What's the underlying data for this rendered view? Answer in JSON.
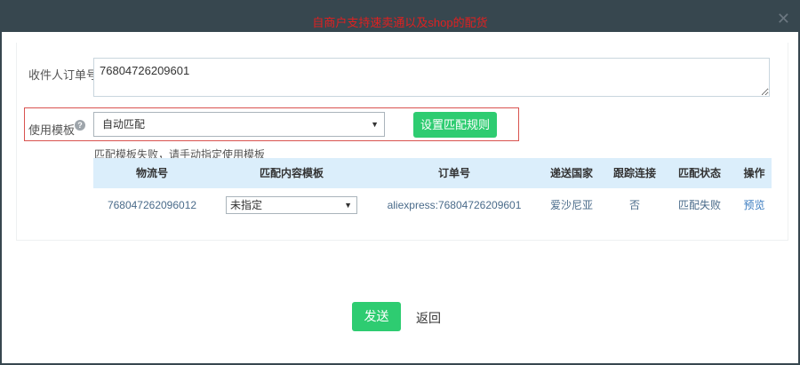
{
  "window": {
    "title": "自商户支持速卖通以及shop的配货"
  },
  "form": {
    "recipient_label": "收件人订单号",
    "recipient_value": "76804726209601",
    "template_label": "使用模板",
    "template_selected": "自动匹配",
    "rules_button": "设置匹配规则",
    "fail_message": "匹配模板失败，请手动指定使用模板"
  },
  "table": {
    "headers": [
      "物流号",
      "匹配内容模板",
      "订单号",
      "递送国家",
      "跟踪连接",
      "匹配状态",
      "操作"
    ],
    "rows": [
      {
        "tracking": "768047262096012",
        "template": "未指定",
        "order": "aliexpress:76804726209601",
        "country": "爱沙尼亚",
        "track_link": "否",
        "status": "匹配失败",
        "action": "预览"
      }
    ]
  },
  "footer": {
    "send_button": "发送",
    "back_link": "返回"
  },
  "colors": {
    "accent": "#2ecc71",
    "title_text": "#e02020",
    "header_bg": "#dbeefb",
    "frame": "#37474f"
  }
}
